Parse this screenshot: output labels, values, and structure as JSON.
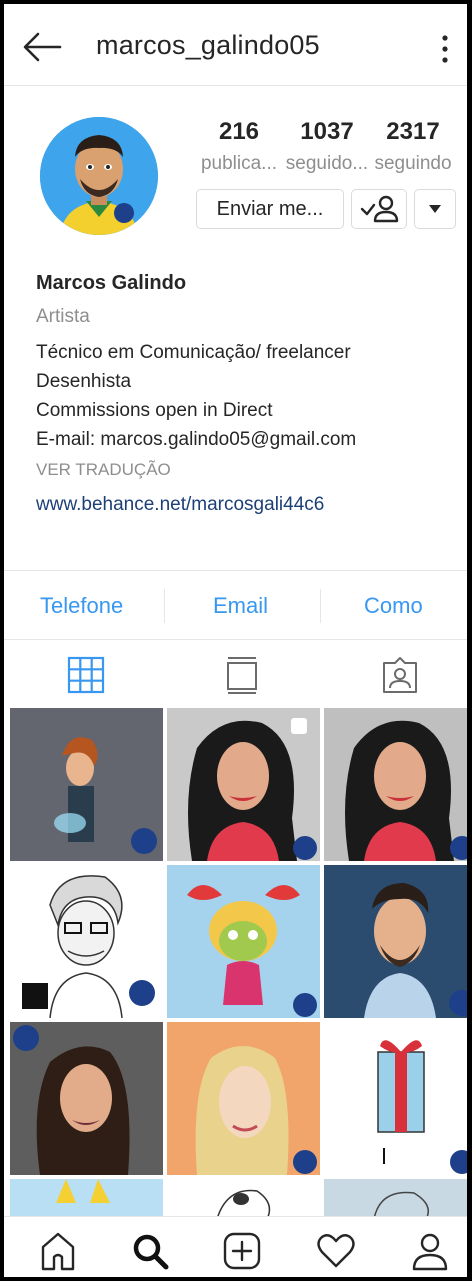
{
  "header": {
    "username": "marcos_galindo05",
    "back_icon": "arrow-left-icon",
    "menu_icon": "more-vertical-icon"
  },
  "profile": {
    "posts_count": "216",
    "posts_label": "publica...",
    "followers_count": "1037",
    "followers_label": "seguido...",
    "following_count": "2317",
    "following_label": "seguindo",
    "message_button": "Enviar me..."
  },
  "bio": {
    "name": "Marcos Galindo",
    "category": "Artista",
    "lines": [
      "Técnico em Comunicação/ freelancer",
      "Desenhista",
      "Commissions open in Direct",
      "E-mail: marcos.galindo05@gmail.com"
    ],
    "translate": "VER TRADUÇÃO",
    "link": "www.behance.net/marcosgali44c6"
  },
  "contacts": {
    "phone": "Telefone",
    "email": "Email",
    "directions": "Como"
  },
  "colors": {
    "accent": "#3897f0",
    "link": "#1d3f78",
    "muted": "#8e8e8e",
    "text": "#262626"
  }
}
